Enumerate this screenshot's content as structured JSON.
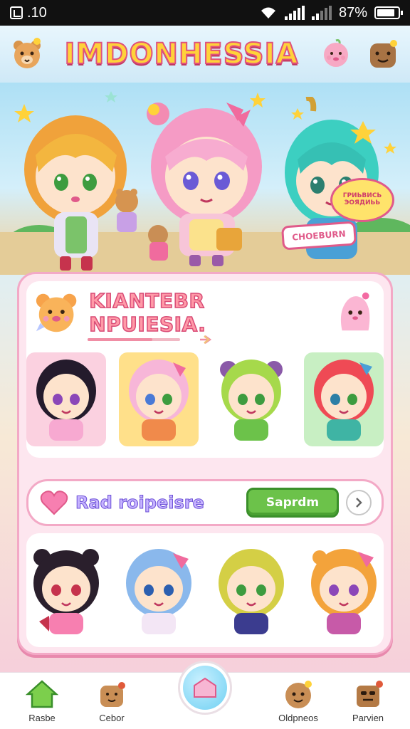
{
  "status_bar": {
    "time": ".10",
    "battery_text": "87%",
    "battery_level": 0.87
  },
  "header": {
    "title": "IMDONHESSIA",
    "left_icon": "bear-face-icon",
    "right_icons": [
      "pink-blob-icon",
      "brown-face-icon"
    ]
  },
  "hero": {
    "speech_text": "ГРИЬВИСЬ ЭОЯДИЬЬ",
    "badge_text": "CHOEBURN"
  },
  "section": {
    "title": "KIANTEBR NPUIESIA.",
    "progress": 0.7,
    "characters_row1": [
      {
        "name": "char-black-hair",
        "bg": "#fbd1e0"
      },
      {
        "name": "char-pink-hair",
        "bg": "#ffe08a"
      },
      {
        "name": "char-green-hair",
        "bg": "#ffffff"
      },
      {
        "name": "char-red-hair",
        "bg": "#c8efc3"
      }
    ]
  },
  "action_bar": {
    "title": "Rad roipeisre",
    "button_label": "Saprdm",
    "next_icon": "chevron-right-icon"
  },
  "characters_row2": [
    {
      "name": "char-bear-black"
    },
    {
      "name": "char-blue-hair"
    },
    {
      "name": "char-yellow-hair"
    },
    {
      "name": "char-orange-hair"
    }
  ],
  "bottom_nav": {
    "items": [
      {
        "label": "Rasbe",
        "icon": "house-icon"
      },
      {
        "label": "Cebor",
        "icon": "bear-icon"
      },
      {
        "label": "Oldpneos",
        "icon": "bear-face-icon"
      },
      {
        "label": "Parvien",
        "icon": "box-face-icon"
      }
    ],
    "center_icon": "home-center-icon"
  },
  "colors": {
    "accent_pink": "#e05a8a",
    "title_yellow": "#ffd23a",
    "button_green": "#6cc24a"
  }
}
